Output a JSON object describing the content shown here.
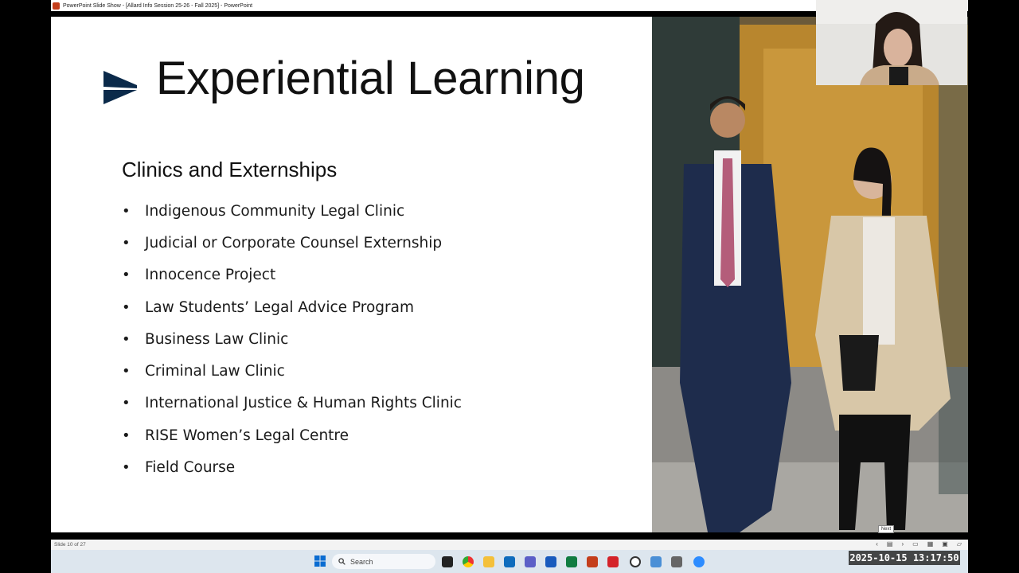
{
  "window": {
    "title": "PowerPoint Slide Show - [Allard Info Session 25-26 - Fall 2025] - PowerPoint"
  },
  "slide": {
    "title": "Experiential Learning",
    "subtitle": "Clinics and Externships",
    "bullets": [
      "Indigenous Community Legal Clinic",
      "Judicial or Corporate Counsel Externship",
      "Innocence Project",
      "Law Students’ Legal Advice Program",
      "Business Law Clinic",
      "Criminal Law Clinic",
      "International Justice & Human Rights Clinic",
      "RISE Women’s Legal Centre",
      "Field Course"
    ],
    "bullet_char": "•",
    "accent_color": "#0b2a4a"
  },
  "status": {
    "slide_counter": "Slide 10 of 27",
    "next_tooltip": "Next"
  },
  "taskbar": {
    "search_placeholder": "Search"
  },
  "overlay": {
    "timestamp": "2025-10-15  13:17:50"
  }
}
